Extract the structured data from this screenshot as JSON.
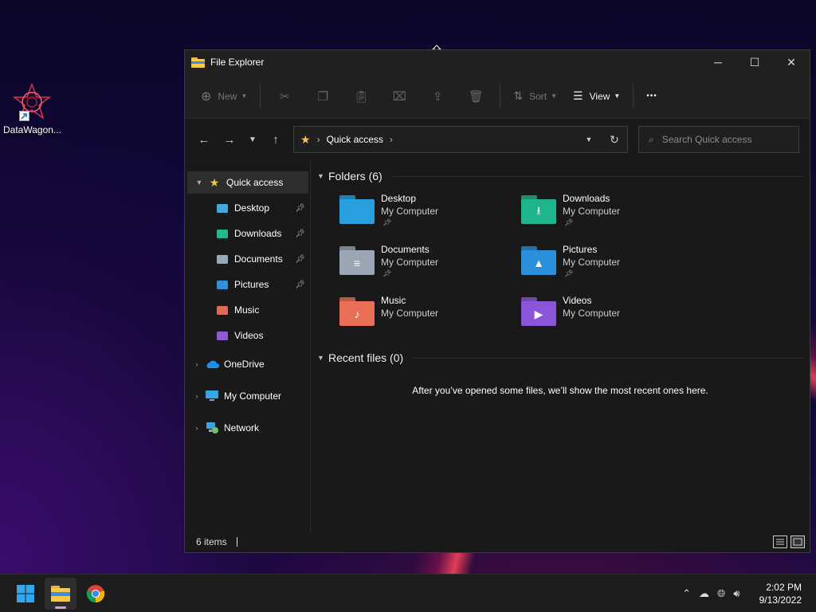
{
  "desktop": {
    "icon_label": "DataWagon...",
    "icon_name": "datawagon-app-icon"
  },
  "window": {
    "title": "File Explorer",
    "caption_buttons": {
      "minimize": "─",
      "maximize": "☐",
      "close": "✕"
    },
    "toolbar": {
      "new_label": "New",
      "sort_label": "Sort",
      "view_label": "View",
      "more_label": "•••"
    },
    "address": {
      "location": "Quick access"
    },
    "search": {
      "placeholder": "Search Quick access"
    },
    "sidebar": {
      "quick_access": "Quick access",
      "pinned": [
        {
          "label": "Desktop",
          "icon": "desktop-folder-icon",
          "color": "#3fa9e0",
          "pinned": true
        },
        {
          "label": "Downloads",
          "icon": "downloads-folder-icon",
          "color": "#22b98a",
          "pinned": true
        },
        {
          "label": "Documents",
          "icon": "documents-folder-icon",
          "color": "#9aa7b5",
          "pinned": true
        },
        {
          "label": "Pictures",
          "icon": "pictures-folder-icon",
          "color": "#2f8fd8",
          "pinned": true
        },
        {
          "label": "Music",
          "icon": "music-folder-icon",
          "color": "#e06a5a",
          "pinned": false
        },
        {
          "label": "Videos",
          "icon": "videos-folder-icon",
          "color": "#8b5bd6",
          "pinned": false
        }
      ],
      "onedrive": "OneDrive",
      "my_computer": "My Computer",
      "network": "Network"
    },
    "content": {
      "folders_header": "Folders (6)",
      "folders": [
        {
          "name": "Desktop",
          "location": "My Computer",
          "pinned": true,
          "color": "#2a9fe0",
          "glyph": ""
        },
        {
          "name": "Downloads",
          "location": "My Computer",
          "pinned": true,
          "color": "#1fb58c",
          "glyph": "⭳"
        },
        {
          "name": "Documents",
          "location": "My Computer",
          "pinned": true,
          "color": "#9aa6b3",
          "glyph": "≡"
        },
        {
          "name": "Pictures",
          "location": "My Computer",
          "pinned": true,
          "color": "#2b8fdc",
          "glyph": "▲"
        },
        {
          "name": "Music",
          "location": "My Computer",
          "pinned": false,
          "color": "#e86f55",
          "glyph": "♪"
        },
        {
          "name": "Videos",
          "location": "My Computer",
          "pinned": false,
          "color": "#8a55d8",
          "glyph": "▶"
        }
      ],
      "recent_header": "Recent files (0)",
      "recent_empty": "After you’ve opened some files, we’ll show the most recent ones here."
    },
    "status": {
      "item_count": "6 items"
    }
  },
  "taskbar": {
    "clock_time": "2:02 PM",
    "clock_date": "9/13/2022",
    "apps": [
      "start-button",
      "file-explorer-app",
      "chrome-app"
    ]
  }
}
